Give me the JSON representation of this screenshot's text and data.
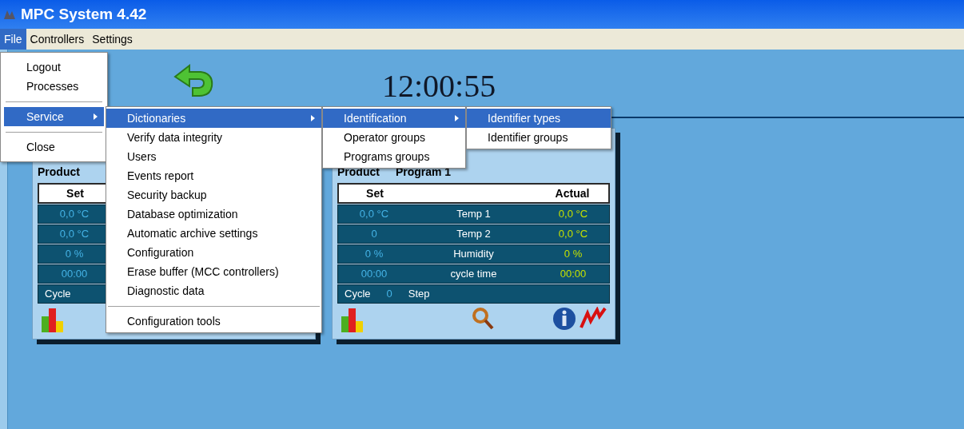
{
  "window": {
    "title": "MPC System 4.42"
  },
  "menubar": [
    {
      "label": "File",
      "selected": true
    },
    {
      "label": "Controllers",
      "selected": false
    },
    {
      "label": "Settings",
      "selected": false
    }
  ],
  "clock": "12:00:55",
  "panels": [
    {
      "product_label": "Product",
      "header": {
        "set": "Set"
      },
      "rows": [
        {
          "set": "0,0 °C"
        },
        {
          "set": "0,0 °C"
        },
        {
          "set": "0 %"
        },
        {
          "set": "00:00"
        }
      ],
      "cycle": {
        "label": "Cycle"
      }
    },
    {
      "product_label": "Product",
      "program": "Program 1",
      "header": {
        "set": "Set",
        "actual": "Actual"
      },
      "rows": [
        {
          "set": "0,0 °C",
          "name": "Temp 1",
          "actual": "0,0 °C"
        },
        {
          "set": "0",
          "name": "Temp 2",
          "actual": "0,0 °C"
        },
        {
          "set": "0 %",
          "name": "Humidity",
          "actual": "0 %"
        },
        {
          "set": "00:00",
          "name": "cycle time",
          "actual": "00:00"
        }
      ],
      "cycle": {
        "label": "Cycle",
        "count": "0",
        "step": "Step"
      }
    }
  ],
  "menus": [
    {
      "items": [
        {
          "kind": "item",
          "label": "Logout",
          "selected": false,
          "submenu": false
        },
        {
          "kind": "item",
          "label": "Processes",
          "selected": false,
          "submenu": false
        },
        {
          "kind": "separator"
        },
        {
          "kind": "item",
          "label": "Service",
          "selected": true,
          "submenu": true
        },
        {
          "kind": "separator"
        },
        {
          "kind": "item",
          "label": "Close",
          "selected": false,
          "submenu": false
        }
      ]
    },
    {
      "items": [
        {
          "kind": "item",
          "label": "Dictionaries",
          "selected": true,
          "submenu": true
        },
        {
          "kind": "item",
          "label": "Verify data integrity",
          "selected": false,
          "submenu": false
        },
        {
          "kind": "item",
          "label": "Users",
          "selected": false,
          "submenu": false
        },
        {
          "kind": "item",
          "label": "Events report",
          "selected": false,
          "submenu": false
        },
        {
          "kind": "item",
          "label": "Security backup",
          "selected": false,
          "submenu": false
        },
        {
          "kind": "item",
          "label": "Database optimization",
          "selected": false,
          "submenu": false
        },
        {
          "kind": "item",
          "label": "Automatic archive settings",
          "selected": false,
          "submenu": false
        },
        {
          "kind": "item",
          "label": "Configuration",
          "selected": false,
          "submenu": false
        },
        {
          "kind": "item",
          "label": "Erase buffer (MCC controllers)",
          "selected": false,
          "submenu": false
        },
        {
          "kind": "item",
          "label": "Diagnostic data",
          "selected": false,
          "submenu": false
        },
        {
          "kind": "separator"
        },
        {
          "kind": "item",
          "label": "Configuration tools",
          "selected": false,
          "submenu": false
        }
      ]
    },
    {
      "items": [
        {
          "kind": "item",
          "label": "Identification",
          "selected": true,
          "submenu": true
        },
        {
          "kind": "item",
          "label": "Operator groups",
          "selected": false,
          "submenu": false
        },
        {
          "kind": "item",
          "label": "Programs groups",
          "selected": false,
          "submenu": false
        }
      ]
    },
    {
      "items": [
        {
          "kind": "item",
          "label": "Identifier types",
          "selected": true,
          "submenu": false
        },
        {
          "kind": "item",
          "label": "Identifier groups",
          "selected": false,
          "submenu": false
        }
      ]
    }
  ]
}
